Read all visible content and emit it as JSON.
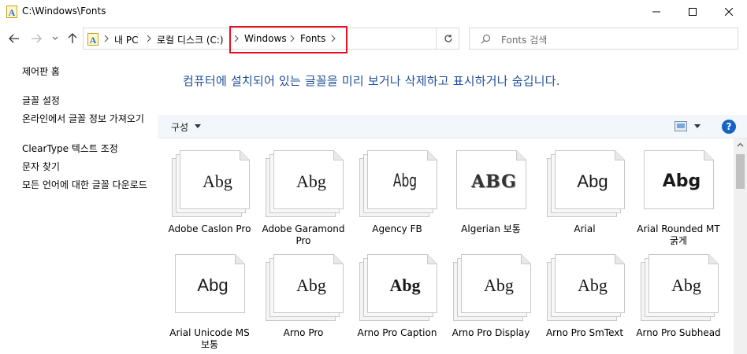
{
  "window": {
    "title": "C:\\Windows\\Fonts"
  },
  "address": {
    "crumbs": [
      "내 PC",
      "로컬 디스크 (C:)",
      "Windows",
      "Fonts"
    ]
  },
  "search": {
    "placeholder": "Fonts 검색"
  },
  "left_pane": {
    "items": [
      "제어판 홈",
      "글꼴 설정",
      "온라인에서 글꼴 정보 가져오기",
      "ClearType 텍스트 조정",
      "문자 찾기",
      "모든 언어에 대한 글꼴 다운로드"
    ]
  },
  "header": {
    "text": "컴퓨터에 설치되어 있는 글꼴을 미리 보거나 삭제하고 표시하거나 숨깁니다."
  },
  "toolbar": {
    "organize_label": "구성",
    "help_label": "?"
  },
  "fonts": [
    {
      "name": "Adobe Caslon Pro",
      "sample": "Abg",
      "stacked": true
    },
    {
      "name": "Adobe Garamond Pro",
      "sample": "Abg",
      "stacked": true
    },
    {
      "name": "Agency FB",
      "sample": "Abg",
      "stacked": true
    },
    {
      "name": "Algerian 보통",
      "sample": "ABG",
      "stacked": false
    },
    {
      "name": "Arial",
      "sample": "Abg",
      "stacked": true
    },
    {
      "name": "Arial Rounded MT 굵게",
      "sample": "Abg",
      "stacked": false
    },
    {
      "name": "Arial Unicode MS 보통",
      "sample": "Abg",
      "stacked": false
    },
    {
      "name": "Arno Pro",
      "sample": "Abg",
      "stacked": true
    },
    {
      "name": "Arno Pro Caption",
      "sample": "Abg",
      "stacked": true
    },
    {
      "name": "Arno Pro Display",
      "sample": "Abg",
      "stacked": true
    },
    {
      "name": "Arno Pro SmText",
      "sample": "Abg",
      "stacked": true
    },
    {
      "name": "Arno Pro Subhead",
      "sample": "Abg",
      "stacked": true
    }
  ]
}
